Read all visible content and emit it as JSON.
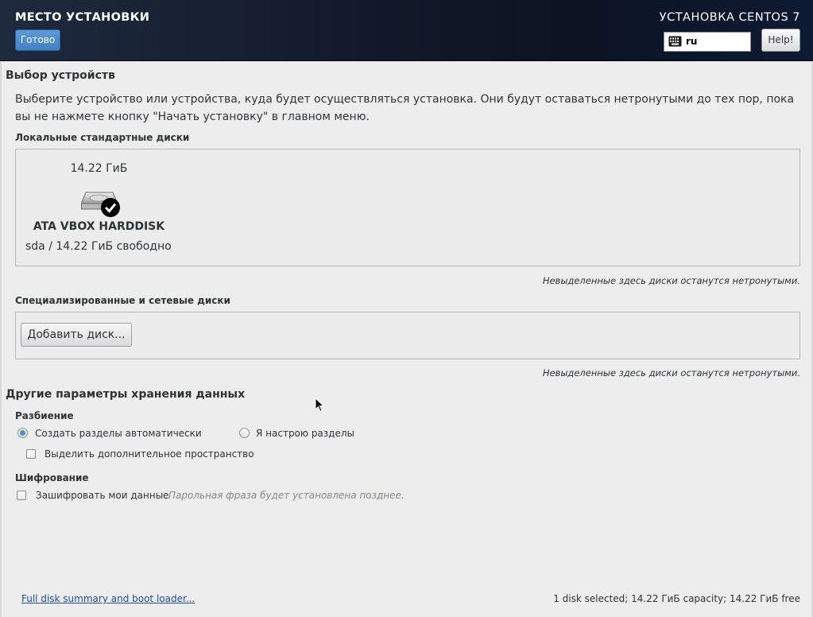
{
  "header": {
    "page_title": "МЕСТО УСТАНОВКИ",
    "done_label": "Готово",
    "product_title": "УСТАНОВКА CENTOS 7",
    "keyboard_layout": "ru",
    "help_label": "Help!"
  },
  "device_selection": {
    "heading": "Выбор устройств",
    "description": "Выберите устройство или устройства, куда будет осуществляться установка. Они будут оставаться нетронутыми до тех пор, пока вы не нажмете кнопку \"Начать установку\" в главном меню.",
    "local_disks_heading": "Локальные стандартные диски",
    "disk": {
      "size": "14.22 ГиБ",
      "name": "ATA VBOX HARDDISK",
      "detail": "sda  /  14.22 ГиБ свободно",
      "selected": true
    },
    "local_note": "Невыделенные здесь диски останутся нетронутыми.",
    "network_disks_heading": "Специализированные и сетевые диски",
    "add_disk_label": "Добавить диск...",
    "network_note": "Невыделенные здесь диски останутся нетронутыми."
  },
  "storage_options": {
    "heading": "Другие параметры хранения данных",
    "partitioning_heading": "Разбиение",
    "auto_partition_label": "Создать разделы автоматически",
    "manual_partition_label": "Я настрою разделы",
    "reclaim_space_label": "Выделить дополнительное пространство",
    "encryption_heading": "Шифрование",
    "encrypt_label": "Зашифровать мои данные",
    "encrypt_hint": "Парольная фраза будет установлена позднее."
  },
  "footer": {
    "summary_link": "Full disk summary and boot loader...",
    "status": "1 disk selected; 14.22 ГиБ capacity; 14.22 ГиБ free"
  },
  "colors": {
    "accent": "#4a90d9",
    "header_bg": "#13192a",
    "link": "#1a4fa1"
  }
}
